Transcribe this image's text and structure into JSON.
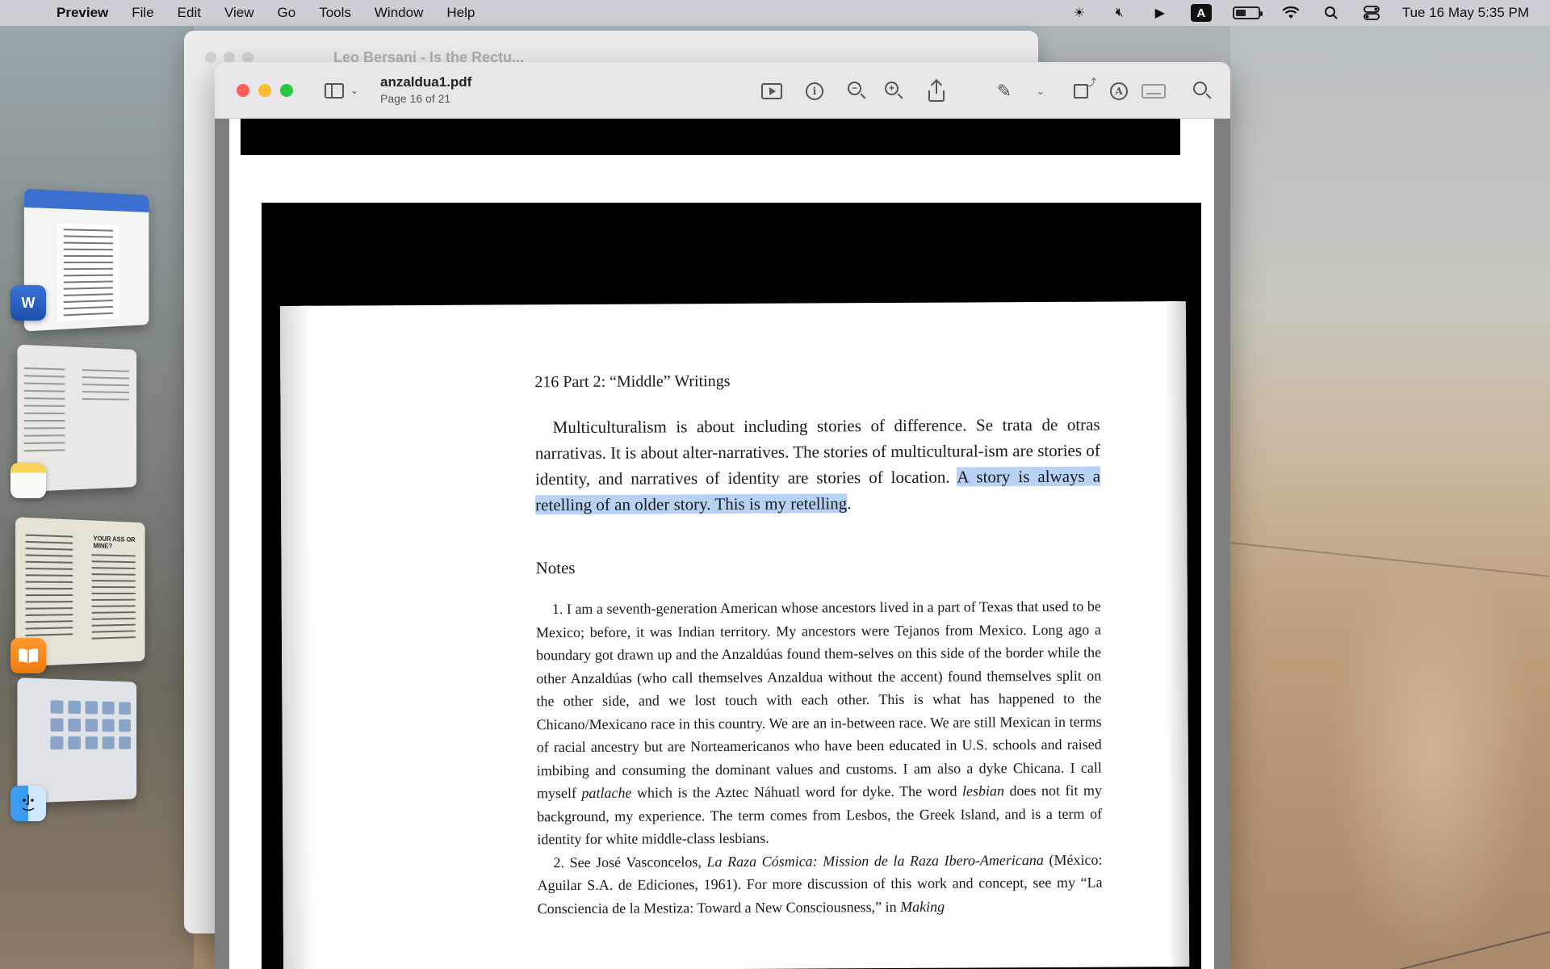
{
  "menubar": {
    "app_name": "Preview",
    "items": [
      "File",
      "Edit",
      "View",
      "Go",
      "Tools",
      "Window",
      "Help"
    ],
    "input_source": "A",
    "clock": "Tue 16 May  5:35 PM"
  },
  "back_window": {
    "title": "Leo Bersani - Is the Rectu..."
  },
  "window": {
    "filename": "anzaldua1.pdf",
    "page_indicator": "Page 16 of 21"
  },
  "stage_manager": {
    "books_heading": "YOUR ASS OR MINE?",
    "word_badge": "W"
  },
  "document": {
    "running_head": "216  Part 2: “Middle” Writings",
    "paragraph_plain": "Multiculturalism is about including stories of difference. Se trata de otras narrativas. It is about alter-narratives. The stories of multicultural-ism are stories of identity, and narratives of identity are stories of location. ",
    "paragraph_highlight": "A story is always a retelling of an older story. This is my retelling",
    "paragraph_end": ".",
    "notes_heading": "Notes",
    "note1_a": "1. I am a seventh-generation American whose ancestors lived in a part of Texas that used to be Mexico; before, it was Indian territory. My ancestors were Tejanos from Mexico. Long ago a boundary got drawn up and the Anzaldúas found them-selves on this side of the border while the other Anzaldúas (who call themselves Anzaldua without the accent) found themselves split on the other side, and we lost touch with each other. This is what has happened to the Chicano/Mexicano race in this country. We are an in-between race. We are still Mexican in terms of racial ancestry but are Norteamericanos who have been educated in U.S. schools and raised imbibing and consuming the dominant values and customs. I am also a dyke Chicana. I call myself ",
    "note1_i1": "patlache",
    "note1_b": " which is the Aztec Náhuatl word for dyke. The word ",
    "note1_i2": "lesbian",
    "note1_c": " does not fit my background, my experience. The term comes from Lesbos, the Greek Island, and is a term of identity for white middle-class lesbians.",
    "note2_a": "2. See José Vasconcelos, ",
    "note2_i1": "La Raza Cósmica: Mission de la Raza Ibero-Americana",
    "note2_b": " (México: Aguilar S.A. de Ediciones, 1961). For more discussion of this work and concept, see my “La Consciencia de la Mestiza: Toward a New Consciousness,” in ",
    "note2_i2": "Making"
  }
}
